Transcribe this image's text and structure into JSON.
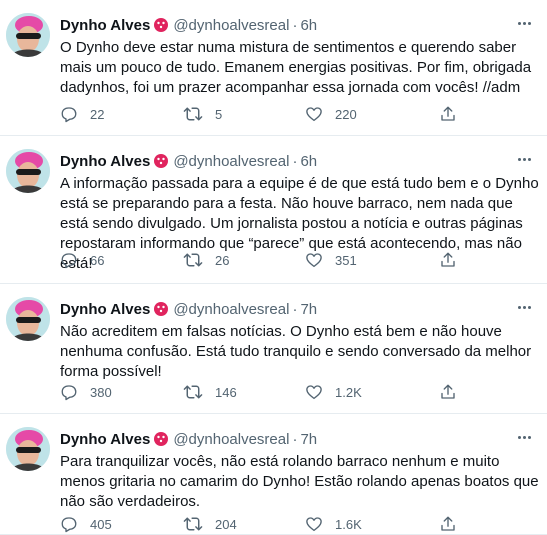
{
  "tweets": [
    {
      "name": "Dynho Alves",
      "handle": "@dynhoalvesreal",
      "separator": "·",
      "time": "6h",
      "text": "O Dynho deve estar numa mistura de sentimentos e querendo saber mais um pouco de tudo. Emanem energias positivas. Por fim, obrigada dadynhos, foi um prazer acompanhar essa jornada com vocês! //adm",
      "replies": "22",
      "retweets": "5",
      "likes": "220"
    },
    {
      "name": "Dynho Alves",
      "handle": "@dynhoalvesreal",
      "separator": "·",
      "time": "6h",
      "text": "A informação passada para a equipe é de que está tudo bem e o Dynho está se preparando para a festa. Não houve barraco, nem nada que está sendo divulgado. Um jornalista postou a notícia e outras páginas repostaram informando que “parece” que está acontecendo, mas não está!",
      "replies": "66",
      "retweets": "26",
      "likes": "351"
    },
    {
      "name": "Dynho Alves",
      "handle": "@dynhoalvesreal",
      "separator": "·",
      "time": "7h",
      "text": "Não acreditem em falsas notícias. O Dynho está bem e não houve nenhuma confusão. Está tudo tranquilo e sendo conversado da melhor forma possível!",
      "replies": "380",
      "retweets": "146",
      "likes": "1.2K"
    },
    {
      "name": "Dynho Alves",
      "handle": "@dynhoalvesreal",
      "separator": "·",
      "time": "7h",
      "text": "Para tranquilizar vocês, não está rolando barraco nenhum e muito menos gritaria no camarim do Dynho! Estão rolando apenas boatos que não são verdadeiros.",
      "replies": "405",
      "retweets": "204",
      "likes": "1.6K"
    }
  ],
  "icons": {
    "avatar": "avatar-photo",
    "verified": "verified-badge-icon",
    "more": "more-icon",
    "reply": "reply-icon",
    "retweet": "retweet-icon",
    "like": "like-icon",
    "share": "share-icon"
  },
  "colors": {
    "text": "#0f1419",
    "muted": "#536471",
    "badge": "#e0245e",
    "divider": "#e6ecf0"
  }
}
